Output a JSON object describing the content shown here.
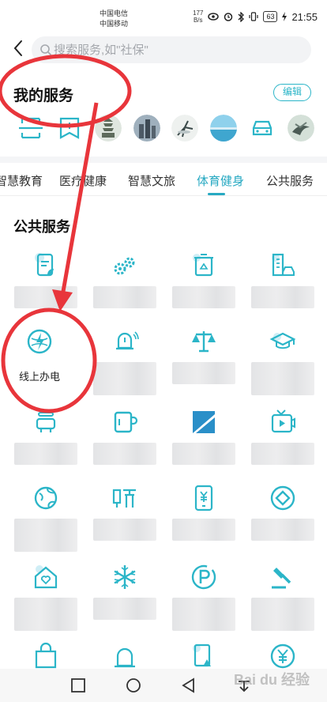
{
  "status_bar": {
    "carrier1": "中国电信",
    "carrier2": "中国移动",
    "speed_value": "177",
    "speed_unit": "B/s",
    "battery": "63",
    "time": "21:55"
  },
  "search": {
    "placeholder": "搜索服务,如\"社保\""
  },
  "my_services": {
    "title": "我的服务",
    "edit_label": "编辑",
    "icons": [
      "frame-icon",
      "bookmark-icon",
      "pagoda-photo",
      "city-photo",
      "crane-photo",
      "sea-photo",
      "car-icon",
      "bird-photo"
    ]
  },
  "tabs": [
    {
      "label": "智慧教育"
    },
    {
      "label": "医疗健康"
    },
    {
      "label": "智慧文旅"
    },
    {
      "label": "体育健身"
    },
    {
      "label": "公共服务"
    }
  ],
  "active_tab": "体育健身",
  "section": {
    "title": "公共服务"
  },
  "grid": {
    "online_power_label": "线上办电",
    "icons": [
      "clipboard-leaf-icon",
      "gears-icon",
      "recycle-bin-icon",
      "buildings-car-icon",
      "lightning-globe-icon",
      "alarm-bell-icon",
      "scales-icon",
      "graduation-cap-icon",
      "bus-icon",
      "cup-icon",
      "slash-tile-icon",
      "video-play-icon",
      "globe-icon",
      "listen-icon",
      "mobile-yuan-icon",
      "target-icon",
      "home-heart-icon",
      "snowflake-icon",
      "parking-icon",
      "gavel-icon",
      "bag-icon",
      "siren-icon",
      "violation-icon",
      "yuan-coin-icon"
    ]
  },
  "colors": {
    "accent": "#27a9c2",
    "annotation": "#e8353b"
  },
  "watermark": "Bai du 经验"
}
